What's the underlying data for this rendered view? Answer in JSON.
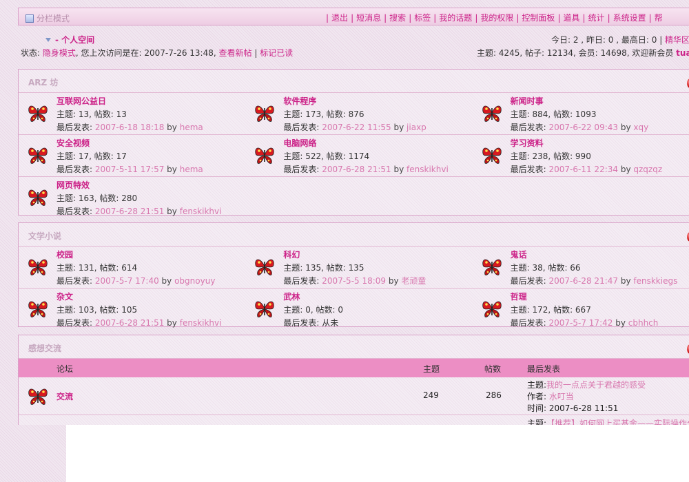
{
  "nav": {
    "mode_label": "分栏模式",
    "links": [
      "退出",
      "短消息",
      "搜索",
      "标签",
      "我的话题",
      "我的权限",
      "控制面板",
      "道具",
      "统计",
      "系统设置",
      "帮"
    ]
  },
  "status": {
    "space_label": "- 个人空间",
    "prefix": "状态: ",
    "mode": "隐身模式",
    "visit_text": ", 您上次访问是在: 2007-7-26 13:48, ",
    "view_new": "查看新帖",
    "mark_read": "标记已读",
    "today": "今日: 2 , 昨日: 0 , 最高日: 0",
    "elite": "精华区",
    "stats": "主题: 4245, 帖子: 12134, 会员: 14698, 欢迎新会员 ",
    "new_member": "tuan"
  },
  "labels": {
    "topics": "主题: ",
    "posts": "帖数: ",
    "last_post": "最后发表: ",
    "by": " by ",
    "never": "从未"
  },
  "sections": [
    {
      "title": "ARZ 坊",
      "rows": [
        [
          {
            "name": "互联网公益日",
            "topics": "13",
            "posts": "13",
            "date": "2007-6-18 18:18",
            "author": "hema"
          },
          {
            "name": "软件程序",
            "topics": "173",
            "posts": "876",
            "date": "2007-6-22 11:55",
            "author": "jiaxp"
          },
          {
            "name": "新闻时事",
            "topics": "884",
            "posts": "1093",
            "date": "2007-6-22 09:43",
            "author": "xqy"
          }
        ],
        [
          {
            "name": "安全视频",
            "topics": "17",
            "posts": "17",
            "date": "2007-5-11 17:57",
            "author": "hema"
          },
          {
            "name": "电脑网络",
            "topics": "522",
            "posts": "1174",
            "date": "2007-6-28 21:51",
            "author": "fenskikhvi"
          },
          {
            "name": "学习资料",
            "topics": "238",
            "posts": "990",
            "date": "2007-6-11 22:34",
            "author": "qzqzqz"
          }
        ],
        [
          {
            "name": "网页特效",
            "topics": "163",
            "posts": "280",
            "date": "2007-6-28 21:51",
            "author": "fenskikhvi"
          }
        ]
      ]
    },
    {
      "title": "文学小说",
      "rows": [
        [
          {
            "name": "校园",
            "topics": "131",
            "posts": "614",
            "date": "2007-5-7 17:40",
            "author": "obgnoyuy"
          },
          {
            "name": "科幻",
            "topics": "135",
            "posts": "135",
            "date": "2007-5-5 18:09",
            "author": "老顽童"
          },
          {
            "name": "鬼话",
            "topics": "38",
            "posts": "66",
            "date": "2007-6-28 21:47",
            "author": "fenskkiegs"
          }
        ],
        [
          {
            "name": "杂文",
            "topics": "103",
            "posts": "105",
            "date": "2007-6-28 21:51",
            "author": "fenskikhvi"
          },
          {
            "name": "武林",
            "topics": "0",
            "posts": "0",
            "date": "",
            "author": ""
          },
          {
            "name": "哲理",
            "topics": "172",
            "posts": "667",
            "date": "2007-5-7 17:42",
            "author": "cbhhch"
          }
        ]
      ]
    }
  ],
  "list_section": {
    "title": "感想交流",
    "headers": {
      "forum": "论坛",
      "topics": "主题",
      "posts": "帖数",
      "last": "最后发表"
    },
    "row": {
      "name": "交流",
      "topics": "249",
      "posts": "286",
      "subject_label": "主题:",
      "subject": "我的一点点关于君越的感受",
      "author_label": "作者: ",
      "author": "水叮当",
      "time_label": "时间: ",
      "time": "2007-6-28 11:51"
    },
    "row2": {
      "subject_label": "主题:",
      "subject": "【推荐】如何网上买基金——实际操作分"
    }
  }
}
